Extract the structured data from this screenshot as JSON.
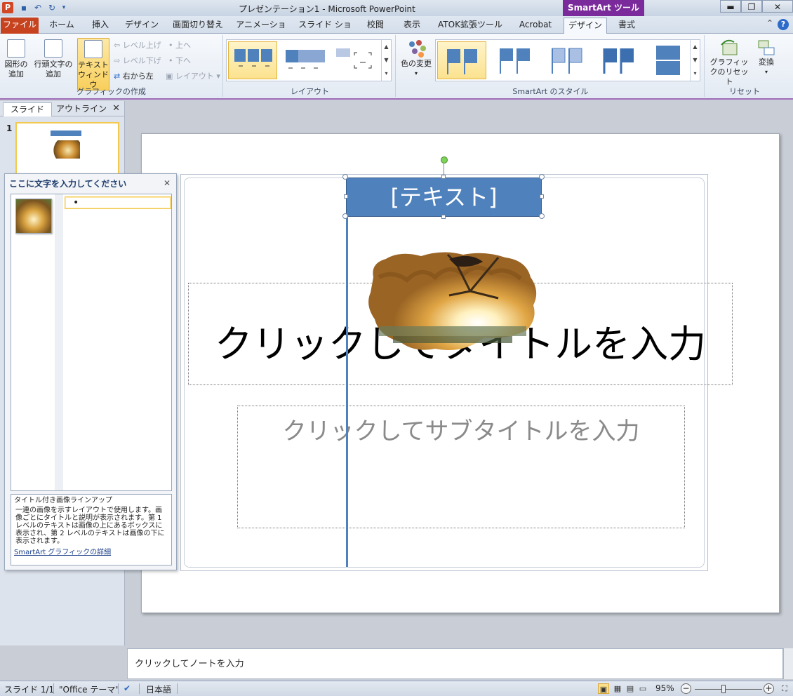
{
  "window": {
    "title": "プレゼンテーション1 - Microsoft PowerPoint",
    "context_tab": "SmartArt ツール"
  },
  "tabs": [
    "ファイル",
    "ホーム",
    "挿入",
    "デザイン",
    "画面切り替え",
    "アニメーション",
    "スライド ショー",
    "校閲",
    "表示",
    "ATOK拡張ツール",
    "Acrobat",
    "デザイン",
    "書式"
  ],
  "ribbon": {
    "create_group": {
      "label": "グラフィックの作成",
      "add_shape": "図形の追加",
      "add_bullet": "行頭文字の追加",
      "text_pane": "テキストウィンドウ",
      "promote": "レベル上げ",
      "demote": "レベル下げ",
      "rtl": "右から左",
      "move_up": "上へ",
      "move_down": "下へ",
      "layout": "レイアウト"
    },
    "layout_group": {
      "label": "レイアウト"
    },
    "styles_group": {
      "label": "SmartArt のスタイル",
      "change_colors": "色の変更"
    },
    "reset_group": {
      "label": "リセット",
      "reset_graphic": "グラフィックのリセット",
      "convert": "変換"
    }
  },
  "left_pane": {
    "tab_slides": "スライド",
    "tab_outline": "アウトライン",
    "slide_number": "1"
  },
  "text_pane": {
    "title": "ここに文字を入力してください",
    "bullet": "•",
    "desc_title": "タイトル付き画像ラインアップ",
    "desc_body": "一連の画像を示すレイアウトで使用します。画像ごとにタイトルと説明が表示されます。第 1 レベルのテキストは画像の上にあるボックスに表示され、第 2 レベルのテキストは画像の下に表示されます。",
    "desc_link": "SmartArt グラフィックの詳細"
  },
  "slide": {
    "smartart_text": "[テキスト]",
    "title_placeholder": "クリックしてタイトルを入力",
    "subtitle_placeholder": "クリックしてサブタイトルを入力"
  },
  "notes": {
    "placeholder": "クリックしてノートを入力"
  },
  "status": {
    "slide": "スライド 1/1",
    "theme": "\"Office テーマ\"",
    "language": "日本語",
    "zoom": "95%"
  },
  "colors": {
    "accent": "#4f81bd",
    "file_tab": "#c7431f",
    "smartart_tools": "#7b2a9c"
  }
}
